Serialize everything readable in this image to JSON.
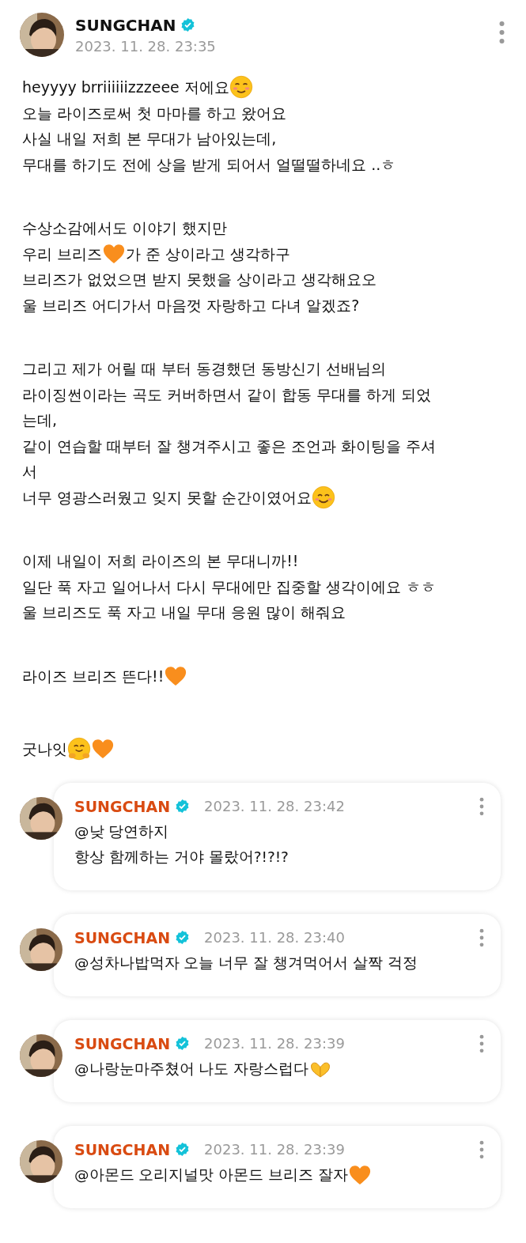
{
  "post": {
    "author": "SUNGCHAN",
    "verified": true,
    "time": "2023. 11. 28. 23:35",
    "paragraphs": [
      [
        [
          {
            "kind": "text",
            "text": "heyyyy brriiiiiizzzeee 저에요"
          },
          {
            "kind": "blush"
          }
        ],
        [
          {
            "kind": "text",
            "text": "오늘 라이즈로써 첫 마마를 하고 왔어요"
          }
        ],
        [
          {
            "kind": "text",
            "text": "사실 내일 저희 본 무대가 남아있는데,"
          }
        ],
        [
          {
            "kind": "text",
            "text": "무대를 하기도 전에 상을 받게 되어서 얼떨떨하네요 ..ㅎ"
          }
        ]
      ],
      [
        [
          {
            "kind": "text",
            "text": "수상소감에서도 이야기 했지만"
          }
        ],
        [
          {
            "kind": "text",
            "text": "우리 브리즈"
          },
          {
            "kind": "heart"
          },
          {
            "kind": "text",
            "text": "가 준 상이라고 생각하구"
          }
        ],
        [
          {
            "kind": "text",
            "text": "브리즈가 없었으면 받지 못했을 상이라고 생각해요오"
          }
        ],
        [
          {
            "kind": "text",
            "text": "울 브리즈 어디가서 마음껏 자랑하고 다녀 알겠죠?"
          }
        ]
      ],
      [
        [
          {
            "kind": "text",
            "text": "그리고 제가 어릴 때 부터 동경했던 동방신기 선배님의"
          }
        ],
        [
          {
            "kind": "text",
            "text": "라이징썬이라는 곡도 커버하면서 같이 합동 무대를 하게 되었"
          }
        ],
        [
          {
            "kind": "text",
            "text": "는데,"
          }
        ],
        [
          {
            "kind": "text",
            "text": "같이 연습할 때부터 잘 챙겨주시고 좋은 조언과 화이팅을 주셔"
          }
        ],
        [
          {
            "kind": "text",
            "text": "서"
          }
        ],
        [
          {
            "kind": "text",
            "text": "너무 영광스러웠고 잊지 못할 순간이였어요"
          },
          {
            "kind": "smile"
          }
        ]
      ],
      [
        [
          {
            "kind": "text",
            "text": "이제 내일이 저희 라이즈의 본 무대니까!!"
          }
        ],
        [
          {
            "kind": "text",
            "text": "일단 푹 자고 일어나서 다시 무대에만 집중할 생각이에요 ㅎㅎ"
          }
        ],
        [
          {
            "kind": "text",
            "text": "울 브리즈도 푹 자고 내일 무대 응원 많이 해줘요"
          }
        ]
      ],
      [
        [
          {
            "kind": "text",
            "text": "라이즈 브리즈 뜬다!!"
          },
          {
            "kind": "heart"
          }
        ]
      ]
    ],
    "signoff": [
      {
        "kind": "text",
        "text": "굿나잇"
      },
      {
        "kind": "hug"
      },
      {
        "kind": "heart"
      }
    ]
  },
  "comments": [
    {
      "author": "SUNGCHAN",
      "verified": true,
      "time": "2023. 11. 28. 23:42",
      "lines": [
        [
          {
            "kind": "text",
            "text": "@낮 당연하지"
          }
        ],
        [
          {
            "kind": "text",
            "text": "항상 함께하는 거야 몰랐어?!?!?"
          }
        ]
      ]
    },
    {
      "author": "SUNGCHAN",
      "verified": true,
      "time": "2023. 11. 28. 23:40",
      "lines": [
        [
          {
            "kind": "text",
            "text": "@성차나밥먹자 오늘 너무 잘 챙겨먹어서 살짝 걱정"
          }
        ]
      ]
    },
    {
      "author": "SUNGCHAN",
      "verified": true,
      "time": "2023. 11. 28. 23:39",
      "lines": [
        [
          {
            "kind": "text",
            "text": "@나랑눈마주쳤어 나도 자랑스럽다"
          },
          {
            "kind": "hands"
          }
        ]
      ]
    },
    {
      "author": "SUNGCHAN",
      "verified": true,
      "time": "2023. 11. 28. 23:39",
      "lines": [
        [
          {
            "kind": "text",
            "text": "@아몬드 오리지널맛 아몬드 브리즈 잘자"
          },
          {
            "kind": "heart"
          }
        ]
      ]
    }
  ]
}
